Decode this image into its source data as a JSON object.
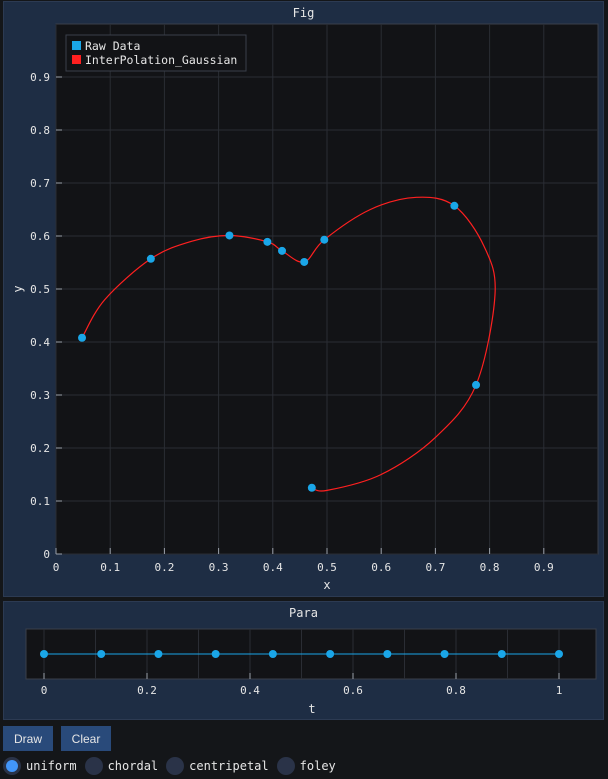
{
  "fig": {
    "title": "Fig",
    "legend": [
      "Raw Data",
      "InterPolation_Gaussian"
    ],
    "xlabel": "x",
    "ylabel": "y",
    "xticks": [
      "0",
      "0.1",
      "0.2",
      "0.3",
      "0.4",
      "0.5",
      "0.6",
      "0.7",
      "0.8",
      "0.9"
    ],
    "yticks": [
      "0",
      "0.1",
      "0.2",
      "0.3",
      "0.4",
      "0.5",
      "0.6",
      "0.7",
      "0.8",
      "0.9"
    ]
  },
  "para": {
    "title": "Para",
    "xlabel": "t",
    "xticks": [
      "0",
      "0.2",
      "0.4",
      "0.6",
      "0.8",
      "1"
    ]
  },
  "buttons": {
    "draw": "Draw",
    "clear": "Clear"
  },
  "radios": [
    {
      "label": "uniform",
      "selected": true
    },
    {
      "label": "chordal",
      "selected": false
    },
    {
      "label": "centripetal",
      "selected": false
    },
    {
      "label": "foley",
      "selected": false
    }
  ],
  "colors": {
    "raw": "#1aa6e8",
    "interp": "#ff2020"
  },
  "chart_data": [
    {
      "type": "scatter",
      "title": "Fig",
      "xlabel": "x",
      "ylabel": "y",
      "xlim": [
        0,
        1.0
      ],
      "ylim": [
        0,
        1.0
      ],
      "grid": true,
      "legend_position": "top-left",
      "series": [
        {
          "name": "Raw Data",
          "x": [
            0.048,
            0.175,
            0.32,
            0.39,
            0.417,
            0.458,
            0.495,
            0.735,
            0.775,
            0.472
          ],
          "y": [
            0.408,
            0.557,
            0.601,
            0.589,
            0.572,
            0.551,
            0.593,
            0.657,
            0.319,
            0.125
          ]
        },
        {
          "name": "InterPolation_Gaussian",
          "x": [
            0.048,
            0.09,
            0.175,
            0.25,
            0.32,
            0.39,
            0.417,
            0.458,
            0.495,
            0.58,
            0.665,
            0.735,
            0.79,
            0.81,
            0.775,
            0.7,
            0.6,
            0.5,
            0.472
          ],
          "y": [
            0.408,
            0.48,
            0.557,
            0.59,
            0.601,
            0.589,
            0.572,
            0.551,
            0.593,
            0.65,
            0.673,
            0.657,
            0.58,
            0.49,
            0.319,
            0.22,
            0.15,
            0.12,
            0.125
          ]
        }
      ]
    },
    {
      "type": "line",
      "title": "Para",
      "xlabel": "t",
      "xlim": [
        0,
        1
      ],
      "series": [
        {
          "x": [
            0,
            0.1111,
            0.2222,
            0.3333,
            0.4444,
            0.5556,
            0.6667,
            0.7778,
            0.8889,
            1.0
          ]
        }
      ]
    }
  ]
}
